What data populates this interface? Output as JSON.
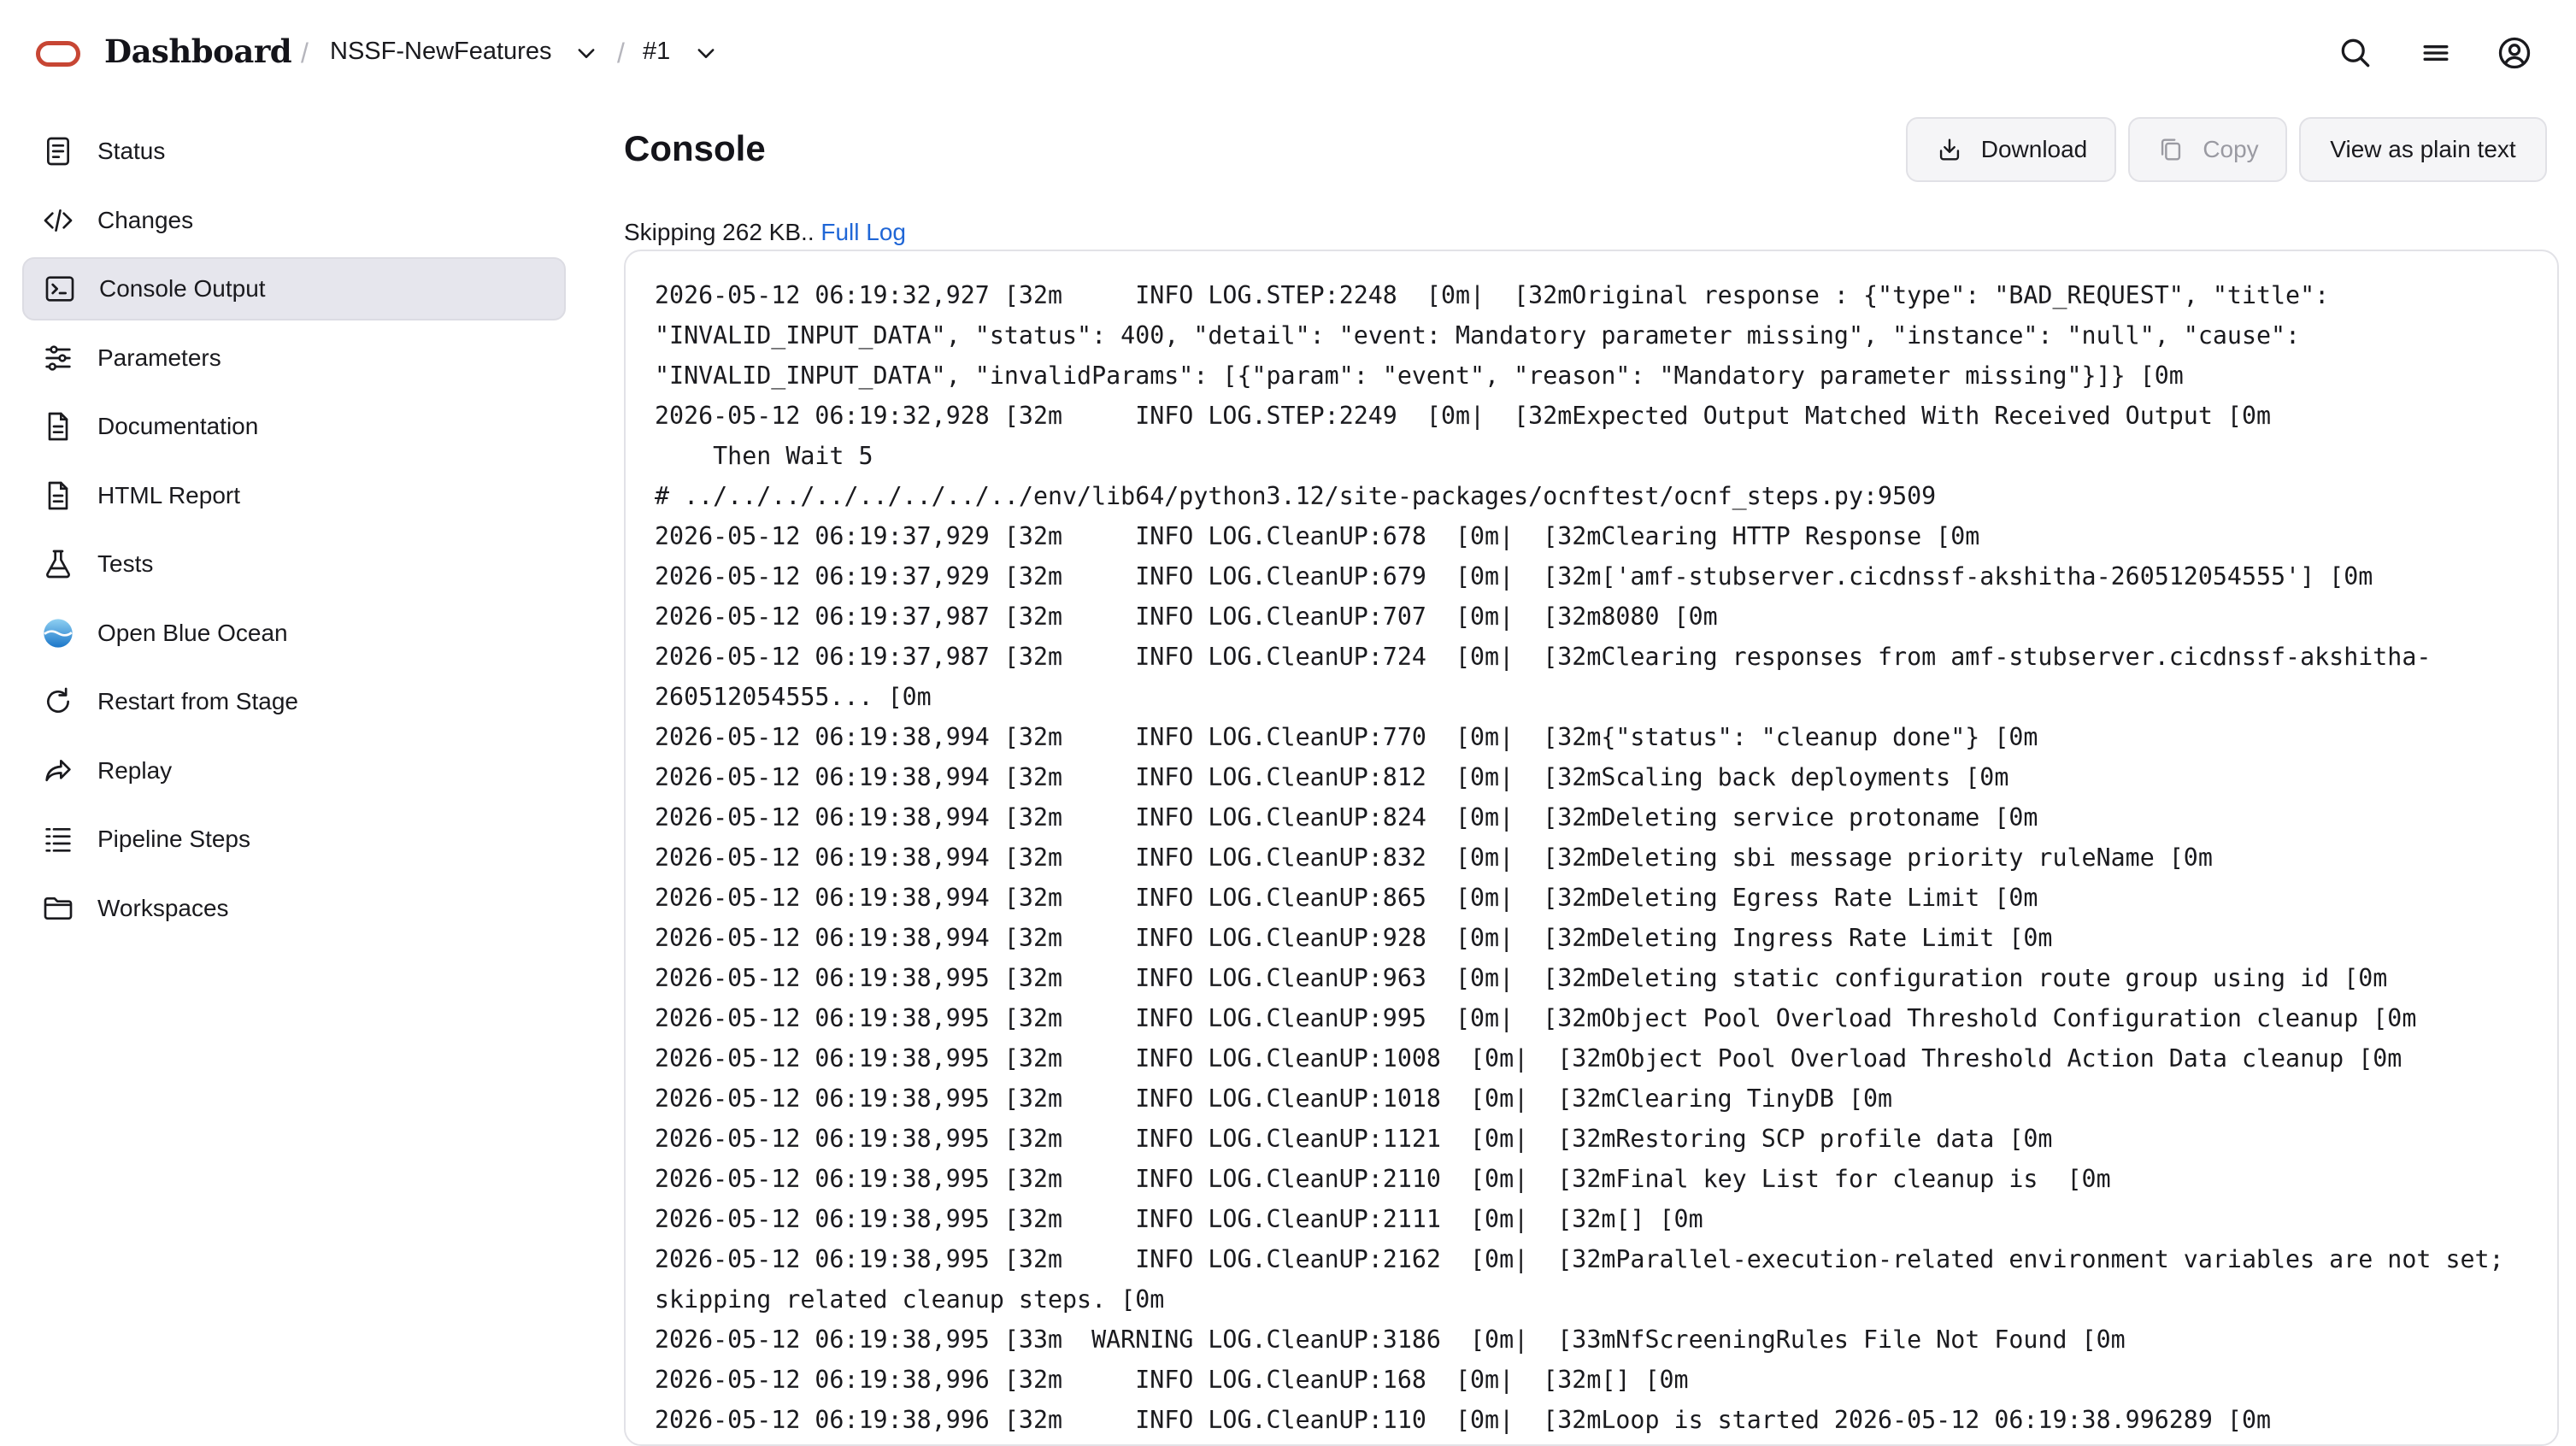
{
  "header": {
    "brand": "Dashboard",
    "breadcrumb": {
      "job": "NSSF-NewFeatures",
      "build": "#1"
    },
    "icons": [
      "search-icon",
      "menu-icon",
      "user-account-icon"
    ]
  },
  "sidebar": {
    "items": [
      {
        "label": "Status",
        "icon": "status-document-icon"
      },
      {
        "label": "Changes",
        "icon": "code-icon"
      },
      {
        "label": "Console Output",
        "icon": "terminal-icon",
        "active": true
      },
      {
        "label": "Parameters",
        "icon": "sliders-icon"
      },
      {
        "label": "Documentation",
        "icon": "document-icon"
      },
      {
        "label": "HTML Report",
        "icon": "report-document-icon"
      },
      {
        "label": "Tests",
        "icon": "flask-icon"
      },
      {
        "label": "Open Blue Ocean",
        "icon": "blue-ocean-icon"
      },
      {
        "label": "Restart from Stage",
        "icon": "restart-icon"
      },
      {
        "label": "Replay",
        "icon": "replay-arrow-icon"
      },
      {
        "label": "Pipeline Steps",
        "icon": "list-steps-icon"
      },
      {
        "label": "Workspaces",
        "icon": "folder-icon"
      }
    ]
  },
  "main": {
    "title": "Console",
    "buttons": {
      "download": "Download",
      "copy": "Copy",
      "plain_text": "View as plain text"
    },
    "skip_text": "Skipping 262 KB..",
    "full_log_link": "Full Log"
  },
  "console": {
    "lines": [
      "2026-05-12 06:19:32,927 [32m     INFO LOG.STEP:2248  [0m|  [32mOriginal response : {\"type\": \"BAD_REQUEST\", \"title\":",
      "\"INVALID_INPUT_DATA\", \"status\": 400, \"detail\": \"event: Mandatory parameter missing\", \"instance\": \"null\", \"cause\":",
      "\"INVALID_INPUT_DATA\", \"invalidParams\": [{\"param\": \"event\", \"reason\": \"Mandatory parameter missing\"}]} [0m",
      "2026-05-12 06:19:32,928 [32m     INFO LOG.STEP:2249  [0m|  [32mExpected Output Matched With Received Output [0m",
      "    Then Wait 5",
      "# ../../../../../../../../env/lib64/python3.12/site-packages/ocnftest/ocnf_steps.py:9509",
      "2026-05-12 06:19:37,929 [32m     INFO LOG.CleanUP:678  [0m|  [32mClearing HTTP Response [0m",
      "2026-05-12 06:19:37,929 [32m     INFO LOG.CleanUP:679  [0m|  [32m['amf-stubserver.cicdnssf-akshitha-260512054555'] [0m",
      "2026-05-12 06:19:37,987 [32m     INFO LOG.CleanUP:707  [0m|  [32m8080 [0m",
      "2026-05-12 06:19:37,987 [32m     INFO LOG.CleanUP:724  [0m|  [32mClearing responses from amf-stubserver.cicdnssf-akshitha-",
      "260512054555... [0m",
      "2026-05-12 06:19:38,994 [32m     INFO LOG.CleanUP:770  [0m|  [32m{\"status\": \"cleanup done\"} [0m",
      "2026-05-12 06:19:38,994 [32m     INFO LOG.CleanUP:812  [0m|  [32mScaling back deployments [0m",
      "2026-05-12 06:19:38,994 [32m     INFO LOG.CleanUP:824  [0m|  [32mDeleting service protoname [0m",
      "2026-05-12 06:19:38,994 [32m     INFO LOG.CleanUP:832  [0m|  [32mDeleting sbi message priority ruleName [0m",
      "2026-05-12 06:19:38,994 [32m     INFO LOG.CleanUP:865  [0m|  [32mDeleting Egress Rate Limit [0m",
      "2026-05-12 06:19:38,994 [32m     INFO LOG.CleanUP:928  [0m|  [32mDeleting Ingress Rate Limit [0m",
      "2026-05-12 06:19:38,995 [32m     INFO LOG.CleanUP:963  [0m|  [32mDeleting static configuration route group using id [0m",
      "2026-05-12 06:19:38,995 [32m     INFO LOG.CleanUP:995  [0m|  [32mObject Pool Overload Threshold Configuration cleanup [0m",
      "2026-05-12 06:19:38,995 [32m     INFO LOG.CleanUP:1008  [0m|  [32mObject Pool Overload Threshold Action Data cleanup [0m",
      "2026-05-12 06:19:38,995 [32m     INFO LOG.CleanUP:1018  [0m|  [32mClearing TinyDB [0m",
      "2026-05-12 06:19:38,995 [32m     INFO LOG.CleanUP:1121  [0m|  [32mRestoring SCP profile data [0m",
      "2026-05-12 06:19:38,995 [32m     INFO LOG.CleanUP:2110  [0m|  [32mFinal key List for cleanup is  [0m",
      "2026-05-12 06:19:38,995 [32m     INFO LOG.CleanUP:2111  [0m|  [32m[] [0m",
      "2026-05-12 06:19:38,995 [32m     INFO LOG.CleanUP:2162  [0m|  [32mParallel-execution-related environment variables are not set;",
      "skipping related cleanup steps. [0m",
      "2026-05-12 06:19:38,995 [33m  WARNING LOG.CleanUP:3186  [0m|  [33mNfScreeningRules File Not Found [0m",
      "2026-05-12 06:19:38,996 [32m     INFO LOG.CleanUP:168  [0m|  [32m[] [0m",
      "2026-05-12 06:19:38,996 [32m     INFO LOG.CleanUP:110  [0m|  [32mLoop is started 2026-05-12 06:19:38.996289 [0m"
    ]
  },
  "colors": {
    "brand_red": "#c74634",
    "link_blue": "#1f66d6",
    "active_bg": "#e6e6ed",
    "button_bg": "#f5f5f7"
  }
}
